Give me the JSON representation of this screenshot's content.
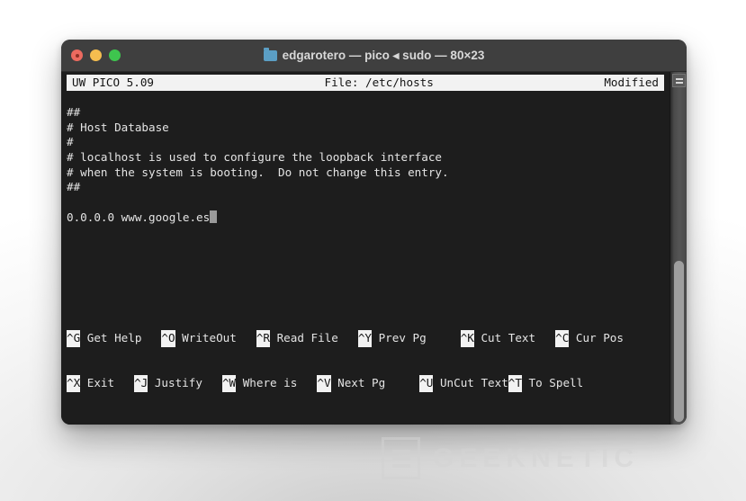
{
  "window": {
    "title": "edgarotero — pico ◂ sudo — 80×23",
    "folder_icon": "folder-icon",
    "traffic_lights": [
      {
        "name": "close-button",
        "color": "#ec6a5f"
      },
      {
        "name": "minimize-button",
        "color": "#f5bd4f"
      },
      {
        "name": "maximize-button",
        "color": "#3ec54e"
      }
    ]
  },
  "pico_header": {
    "version": "UW PICO 5.09",
    "file": "File: /etc/hosts",
    "status": "Modified"
  },
  "file_content": {
    "lines": [
      "##",
      "# Host Database",
      "#",
      "# localhost is used to configure the loopback interface",
      "# when the system is booting.  Do not change this entry.",
      "##",
      "",
      "0.0.0.0 www.google.es"
    ],
    "cursor_line_index": 7
  },
  "shortcuts": {
    "row1": [
      {
        "key": "^G",
        "label": " Get Help"
      },
      {
        "key": "^O",
        "label": " WriteOut"
      },
      {
        "key": "^R",
        "label": " Read File"
      },
      {
        "key": "^Y",
        "label": " Prev Pg"
      },
      {
        "key": "^K",
        "label": " Cut Text"
      },
      {
        "key": "^C",
        "label": " Cur Pos"
      }
    ],
    "row2": [
      {
        "key": "^X",
        "label": " Exit"
      },
      {
        "key": "^J",
        "label": " Justify"
      },
      {
        "key": "^W",
        "label": " Where is"
      },
      {
        "key": "^V",
        "label": " Next Pg"
      },
      {
        "key": "^U",
        "label": " UnCut Text"
      },
      {
        "key": "^T",
        "label": " To Spell"
      }
    ],
    "row1_gaps": [
      0,
      22,
      22,
      22,
      38,
      22
    ],
    "row2_gaps": [
      0,
      22,
      22,
      22,
      38,
      0
    ]
  },
  "watermark": {
    "text": "GEEKNETIC"
  },
  "colors": {
    "titlebar": "#3f3f3f",
    "terminal_bg": "#1d1d1d",
    "terminal_fg": "#e4e4e4",
    "inverse_bg": "#f2f2f2",
    "inverse_fg": "#141414",
    "cursor": "#9a9a9a"
  }
}
